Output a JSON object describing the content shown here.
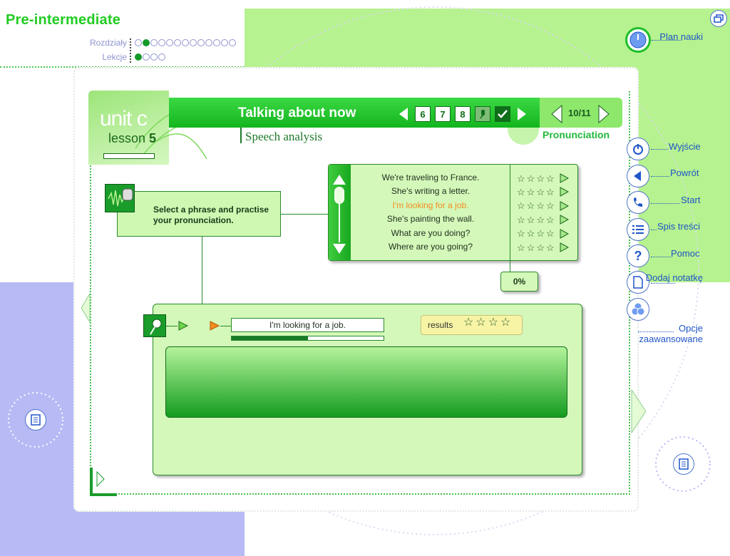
{
  "app": {
    "title": "Pre-intermediate",
    "chapters_label": "Rozdziały",
    "lessons_label": "Lekcje",
    "chapters_total": 13,
    "chapters_active": 2,
    "lessons_total": 4,
    "lessons_active": 1
  },
  "unit": {
    "unit_title": "unit c",
    "lesson_prefix": "lesson",
    "lesson_number": "5"
  },
  "header": {
    "topic": "Talking about now",
    "subtitle": "Speech analysis",
    "section": "Pronunciation",
    "pages": [
      "6",
      "7",
      "8"
    ],
    "page_counter": "10/11"
  },
  "instruction": {
    "text": "Select a phrase and practise your pronunciation."
  },
  "phrases": {
    "items": [
      "We're traveling to France.",
      "She's writing a letter.",
      "I'm looking for a job.",
      "She's painting the wall.",
      "What are you doing?",
      "Where are you going?"
    ],
    "selected_index": 2,
    "percent": "0%"
  },
  "recorder": {
    "current_phrase": "I'm looking for a job.",
    "progress": 0.5,
    "results_label": "results"
  },
  "side_nav": {
    "plan": "Plan nauki",
    "exit": "Wyjście",
    "back": "Powrót",
    "start": "Start",
    "contents": "Spis treści",
    "help": "Pomoc",
    "add_note": "Dodaj notatkę",
    "advanced": "Opcje zaawansowane"
  },
  "colors": {
    "accent": "#13b51e",
    "selected_phrase": "#f28c1e",
    "nav_text": "#1f55c8"
  }
}
